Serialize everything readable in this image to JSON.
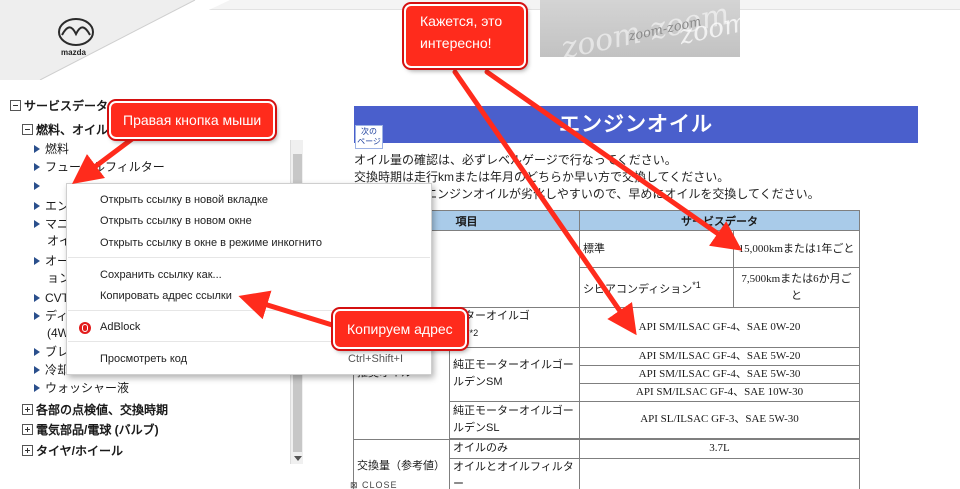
{
  "header": {
    "brand": "mazda",
    "banner_text": "zoom-zoom"
  },
  "tree": {
    "root": "サービスデータ",
    "group_fuel": "燃料、オイル",
    "items": [
      "燃料",
      "フューエルフィルター",
      "",
      "エン",
      "マニ",
      "オイ",
      "オー",
      "ョン",
      "CVT",
      "ディ",
      "(4W",
      "ブレ",
      "冷却",
      "ウォッシャー液"
    ],
    "groups_collapsed": [
      "各部の点検値、交換時期",
      "電気部品/電球 (バルブ)",
      "タイヤ/ホイール"
    ]
  },
  "context_menu": {
    "items": [
      {
        "id": "open_new_tab",
        "label": "Открыть ссылку в новой вкладке"
      },
      {
        "id": "open_new_window",
        "label": "Открыть ссылку в новом окне"
      },
      {
        "id": "open_incognito",
        "label": "Открыть ссылку в окне в режиме инкогнито"
      },
      {
        "id": "save_link",
        "label": "Сохранить ссылку как..."
      },
      {
        "id": "copy_link",
        "label": "Копировать адрес ссылки"
      },
      {
        "id": "adblock",
        "label": "AdBlock"
      },
      {
        "id": "inspect",
        "label": "Просмотреть код",
        "shortcut": "Ctrl+Shift+I"
      }
    ]
  },
  "main": {
    "title": "エンジンオイル",
    "next_button_line1": "次の",
    "next_button_line2": "ページ",
    "paragraphs": [
      "オイル量の確認は、必ずレベルゲージで行なってください。",
      "交換時期は走行kmまたは年月のどちらか早い方で交換してください。",
      "エンジンオイルが劣化しやすいので、早めにオイルを交換してください。"
    ],
    "table": {
      "header_item": "項目",
      "header_data": "サービスデータ",
      "row_standard": "標準",
      "row_standard_value": "15,000kmまたは1年ごと",
      "row_severe": "シビアコンディション",
      "row_severe_sup": "*1",
      "row_severe_value": "7,500kmまたは6か月ごと",
      "oil_category": "推奨オイル",
      "oil_gold_eco": "ーターオイルゴ",
      "oil_gold_eco2": "CO",
      "oil_gold_eco_sup": "*2",
      "oil_gold_eco_value": "API SM/ILSAC GF-4、SAE 0W-20",
      "oil_golden_sm": "純正モーターオイルゴールデンSM",
      "oil_golden_sm_values": [
        "API SM/ILSAC GF-4、SAE 5W-20",
        "API SM/ILSAC GF-4、SAE 5W-30",
        "API SM/ILSAC GF-4、SAE 10W-30"
      ],
      "oil_golden_sl": "純正モーターオイルゴールデンSL",
      "oil_golden_sl_value": "API SL/ILSAC GF-3、SAE 5W-30",
      "capacity_category": "交換量（参考値）",
      "capacity_oil_only": "オイルのみ",
      "capacity_oil_only_value": "3.7L",
      "capacity_with_filter": "オイルとオイルフィルター"
    },
    "close_label": "CLOSE"
  },
  "annotations": {
    "right_click": "Правая кнопка мыши",
    "interesting_line1": "Кажется, это",
    "interesting_line2": "интересно!",
    "copy_address": "Копируем адрес"
  },
  "colors": {
    "title_bar": "#4a5fcc",
    "table_header": "#a9cbe9",
    "callout": "#ff2b1c",
    "arrow": "#ff2b1c"
  }
}
